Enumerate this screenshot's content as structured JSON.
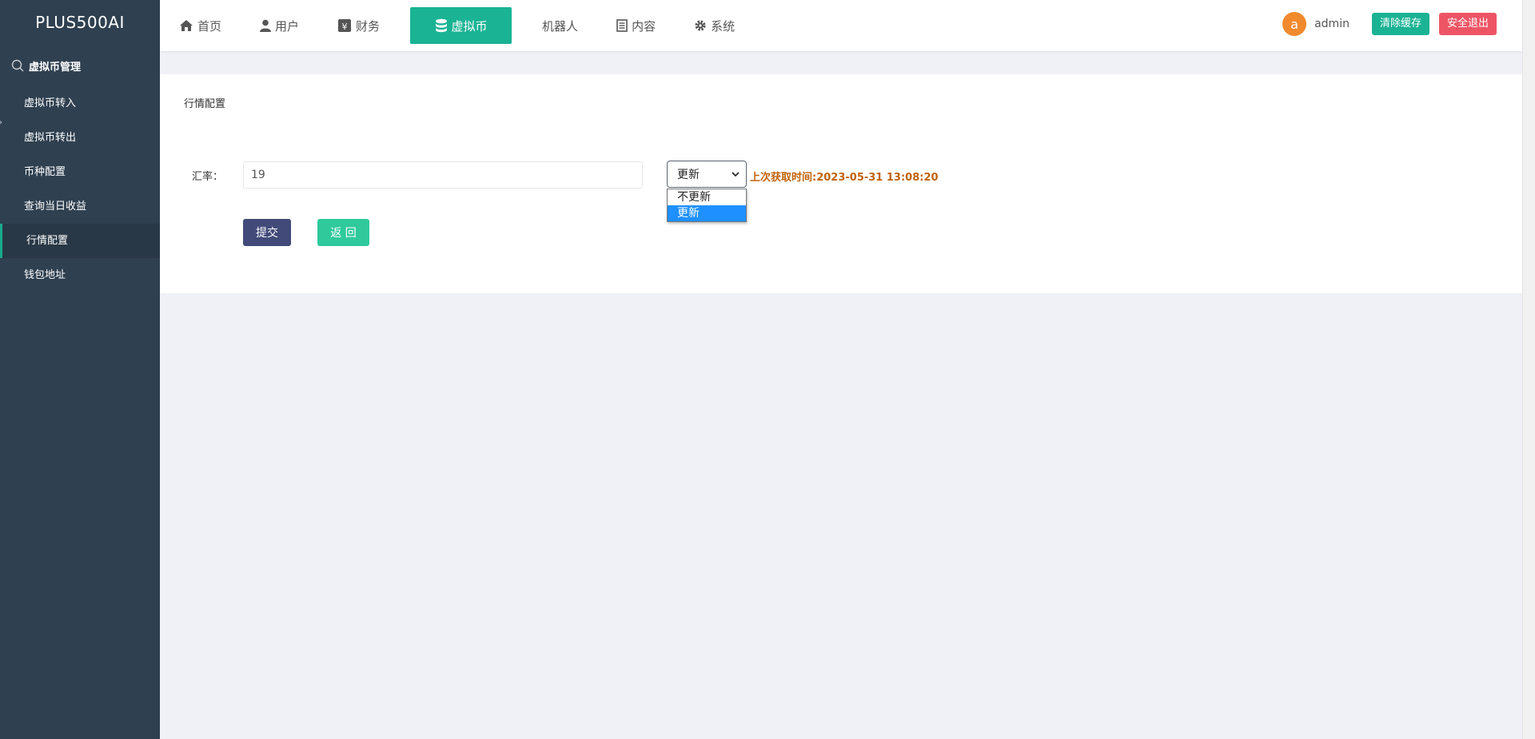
{
  "brand": "PLUS500AI",
  "sidebar": {
    "section_title": "虚拟币管理",
    "items": [
      {
        "label": "虚拟币转入"
      },
      {
        "label": "虚拟币转出"
      },
      {
        "label": "币种配置"
      },
      {
        "label": "查询当日收益"
      },
      {
        "label": "行情配置",
        "active": true
      },
      {
        "label": "钱包地址"
      }
    ]
  },
  "topnav": {
    "items": [
      {
        "label": "首页",
        "icon": "home-icon"
      },
      {
        "label": "用户",
        "icon": "user-icon"
      },
      {
        "label": "财务",
        "icon": "finance-icon"
      },
      {
        "label": "虚拟币",
        "icon": "database-icon",
        "active": true
      },
      {
        "label": "机器人",
        "icon": ""
      },
      {
        "label": "内容",
        "icon": "document-icon"
      },
      {
        "label": "系统",
        "icon": "gear-icon"
      }
    ]
  },
  "user": {
    "avatar_letter": "a",
    "name": "admin",
    "clear_cache_label": "清除缓存",
    "logout_label": "安全退出"
  },
  "form": {
    "panel_title": "行情配置",
    "rate_label": "汇率：",
    "rate_value": "19",
    "select_value": "更新",
    "select_options": [
      {
        "label": "不更新",
        "selected": false
      },
      {
        "label": "更新",
        "selected": true
      }
    ],
    "last_fetch_text": "上次获取时间:2023-05-31 13:08:20",
    "submit_label": "提交",
    "back_label": "返 回"
  },
  "colors": {
    "sidebar_bg": "#2f4050",
    "accent": "#1ab394",
    "danger": "#ed5565",
    "submit": "#414a78",
    "time_text": "#c0620c"
  }
}
